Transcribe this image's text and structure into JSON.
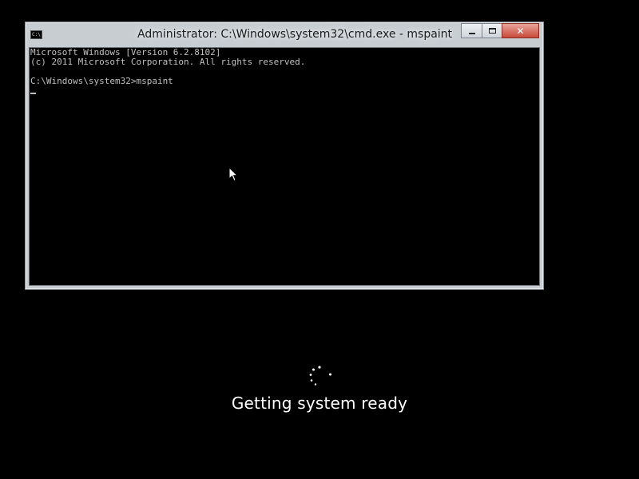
{
  "window": {
    "title": "Administrator: C:\\Windows\\system32\\cmd.exe - mspaint",
    "icon": "cmd-icon",
    "icon_text": "C:\\."
  },
  "console": {
    "lines": [
      "Microsoft Windows [Version 6.2.8102]",
      "(c) 2011 Microsoft Corporation. All rights reserved.",
      "",
      "C:\\Windows\\system32>mspaint"
    ]
  },
  "status": {
    "text": "Getting system ready",
    "spinner_icon": "loading-dots-icon"
  },
  "colors": {
    "background": "#000000",
    "console_text": "#c0c0c0",
    "close_button": "#c84a3a",
    "status_text": "#ffffff"
  }
}
